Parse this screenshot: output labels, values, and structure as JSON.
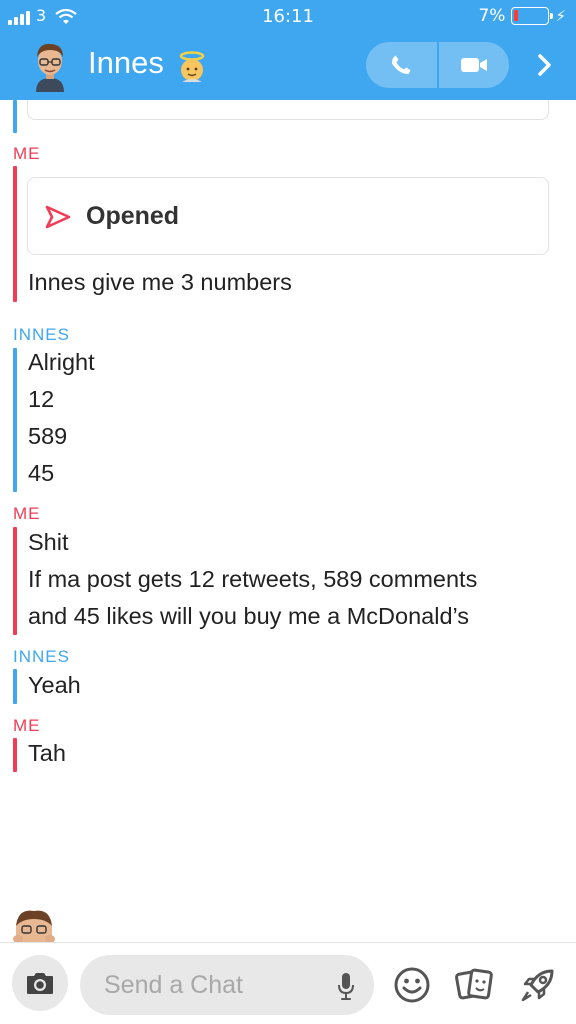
{
  "status_bar": {
    "carrier": "3",
    "time": "16:11",
    "battery": "7%",
    "battery_level": 0.07
  },
  "header": {
    "contact_name": "Innes",
    "icons": [
      "bitmoji-avatar",
      "angel-emoji",
      "phone-icon",
      "video-camera-icon",
      "chevron-right-icon"
    ]
  },
  "colors": {
    "header_blue": "#3ea7f0",
    "me_red": "#f23c57",
    "them_blue": "#3ea7f0"
  },
  "messages": {
    "g1": {
      "sender": "ME",
      "opened_label": "Opened",
      "line1": "Innes give me 3 numbers"
    },
    "g2": {
      "sender": "INNES",
      "line1": "Alright",
      "line2": "12",
      "line3": "589",
      "line4": "45"
    },
    "g3": {
      "sender": "ME",
      "line1": "Shit",
      "line2": "If ma post gets 12 retweets, 589 comments",
      "line3": "and 45 likes will you buy me a McDonald’s"
    },
    "g4": {
      "sender": "INNES",
      "line1": "Yeah"
    },
    "g5": {
      "sender": "ME",
      "line1": "Tah"
    }
  },
  "composer": {
    "placeholder": "Send a Chat",
    "icons": [
      "camera-icon",
      "microphone-icon",
      "smiley-icon",
      "stickers-icon",
      "rocket-icon"
    ]
  }
}
